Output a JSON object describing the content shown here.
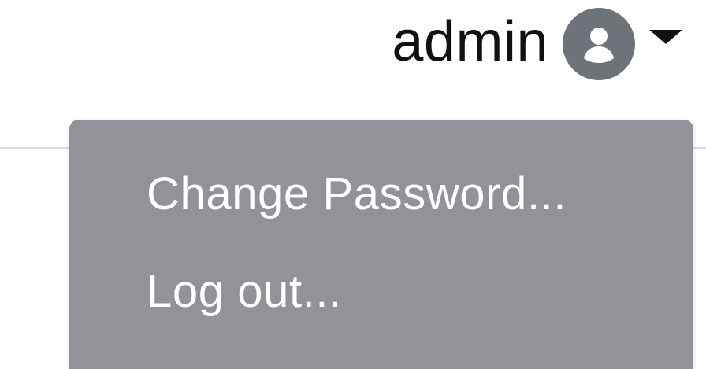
{
  "user_menu": {
    "username": "admin",
    "avatar_icon": "user-circle-icon",
    "caret_icon": "caret-down-icon",
    "items": [
      {
        "label": "Change Password..."
      },
      {
        "label": "Log out..."
      }
    ]
  },
  "colors": {
    "menu_background": "#929398",
    "avatar_background": "#6e737a",
    "menu_text": "#ffffff",
    "username_text": "#111111"
  }
}
